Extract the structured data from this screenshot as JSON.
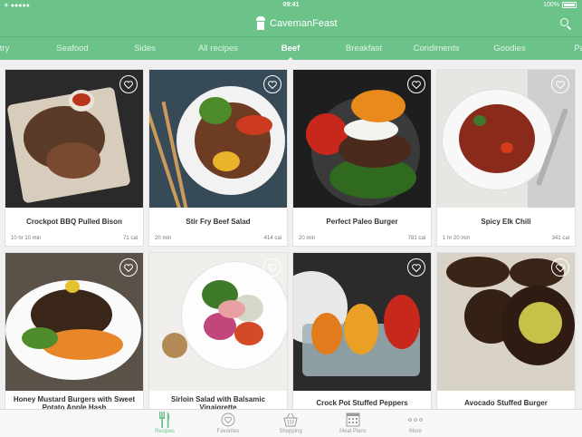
{
  "status_bar": {
    "signal": "✈ ●●●●●",
    "time": "09:41",
    "battery": "100%"
  },
  "header": {
    "app_name": "CavemanFeast"
  },
  "categories": [
    {
      "label": "ltry"
    },
    {
      "label": "Seafood"
    },
    {
      "label": "Sides"
    },
    {
      "label": "All recipes"
    },
    {
      "label": "Beef",
      "active": true
    },
    {
      "label": "Breakfast"
    },
    {
      "label": "Condiments"
    },
    {
      "label": "Goodies"
    },
    {
      "label": "Pa"
    }
  ],
  "recipes": [
    {
      "title": "Crockpot BBQ Pulled Bison",
      "time": "10 hr 10 min",
      "calories": "71 cal",
      "favorite": false
    },
    {
      "title": "Stir Fry Beef Salad",
      "time": "20 min",
      "calories": "414 cal",
      "favorite": false
    },
    {
      "title": "Perfect Paleo Burger",
      "time": "20 min",
      "calories": "781 cal",
      "favorite": false
    },
    {
      "title": "Spicy Elk Chili",
      "time": "1 hr 20 min",
      "calories": "341 cal",
      "favorite": false
    },
    {
      "title": "Honey Mustard Burgers with Sweet Potato Apple Hash",
      "time": "",
      "calories": "",
      "favorite": false
    },
    {
      "title": "Sirloin Salad with Balsamic Vinaigrette",
      "time": "",
      "calories": "",
      "favorite": false
    },
    {
      "title": "Crock Pot Stuffed Peppers",
      "time": "",
      "calories": "",
      "favorite": false
    },
    {
      "title": "Avocado Stuffed Burger",
      "time": "",
      "calories": "",
      "favorite": false
    }
  ],
  "tabbar": [
    {
      "label": "Recipes",
      "icon": "fork-knife-icon",
      "active": true
    },
    {
      "label": "Favorites",
      "icon": "heart-icon",
      "active": false
    },
    {
      "label": "Shopping",
      "icon": "basket-icon",
      "active": false
    },
    {
      "label": "Meal Plans",
      "icon": "calendar-icon",
      "active": false
    },
    {
      "label": "More",
      "icon": "more-dots-icon",
      "active": false
    }
  ],
  "colors": {
    "brand_green": "#6cc38a",
    "active_tab_text": "#ffffff",
    "inactive_tab_text": "#dff3e6"
  }
}
